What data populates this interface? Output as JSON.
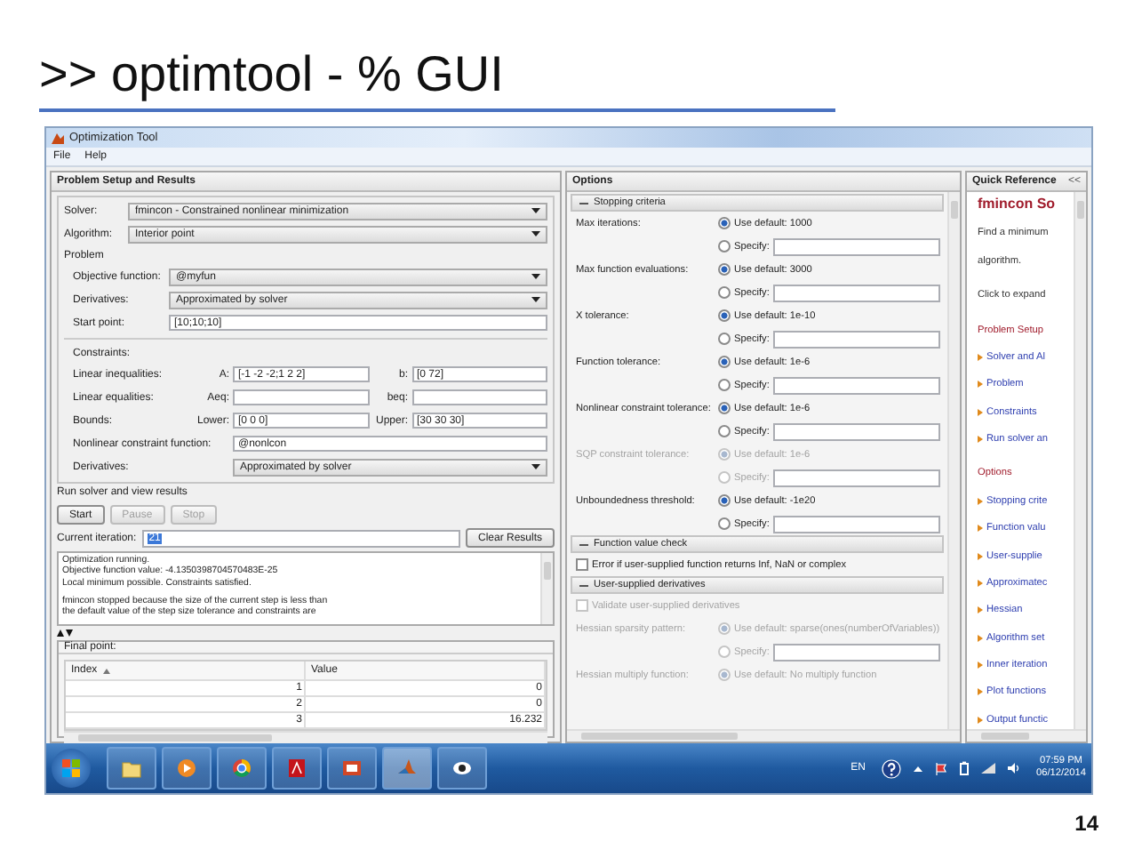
{
  "slide": {
    "title": ">> optimtool - % GUI",
    "page_number": "14"
  },
  "window": {
    "title": "Optimization Tool",
    "menu": [
      "File",
      "Help"
    ]
  },
  "problem_setup": {
    "heading": "Problem Setup and Results",
    "solver": {
      "label": "Solver:",
      "value": "fmincon - Constrained nonlinear minimization"
    },
    "algorithm": {
      "label": "Algorithm:",
      "value": "Interior point"
    },
    "problem_heading": "Problem",
    "problem_fields": [
      {
        "kind": "dropdown",
        "label": "Objective function:",
        "value": "@myfun"
      },
      {
        "kind": "dropdown",
        "label": "Derivatives:",
        "value": "Approximated by solver"
      },
      {
        "kind": "text",
        "label": "Start point:",
        "value": "[10;10;10]"
      }
    ],
    "constraints_heading": "Constraints:",
    "constraint_rows": [
      {
        "label": "Linear inequalities:",
        "fields": [
          {
            "label": "A:",
            "value": "[-1 -2 -2;1 2 2]"
          },
          {
            "label": "b:",
            "value": "[0 72]"
          }
        ]
      },
      {
        "label": "Linear equalities:",
        "fields": [
          {
            "label": "Aeq:"
          },
          {
            "label": "beq:"
          }
        ]
      },
      {
        "label": "Bounds:",
        "fields": [
          {
            "label": "Lower:",
            "value": "[0 0 0]"
          },
          {
            "label": "Upper:",
            "value": "[30 30 30]"
          }
        ]
      }
    ],
    "extra_fields": [
      {
        "kind": "text",
        "label": "Nonlinear constraint function:",
        "value": "@nonlcon"
      },
      {
        "kind": "dropdown",
        "label": "Derivatives:",
        "value": "Approximated by solver"
      }
    ]
  },
  "run": {
    "heading": "Run solver and view results",
    "buttons": [
      {
        "label": "Start",
        "disabled": false
      },
      {
        "label": "Pause",
        "disabled": true
      },
      {
        "label": "Stop",
        "disabled": true
      }
    ],
    "iteration_label": "Current iteration:",
    "iteration_value": "21",
    "clear_button": "Clear Results",
    "log": [
      [
        "Optimization running.",
        "Objective function value: -4.1350398704570483E-25",
        "Local minimum possible. Constraints satisfied."
      ],
      [
        "fmincon stopped because the size of the current step is less than",
        "the default value of the step size tolerance and constraints are"
      ]
    ],
    "final_point": {
      "heading": "Final point:",
      "columns": [
        "Index",
        "Value"
      ],
      "rows": [
        [
          "1",
          "0"
        ],
        [
          "2",
          "0"
        ],
        [
          "3",
          "16.232"
        ]
      ]
    }
  },
  "options": {
    "heading": "Options",
    "sections": [
      {
        "title": "Stopping criteria",
        "expanded": true,
        "items": [
          {
            "kind": "option",
            "label": "Max iterations:",
            "disabled": false,
            "radios": [
              {
                "kind": "default",
                "label": "Use default: 1000",
                "selected": true
              },
              {
                "kind": "specify",
                "label": "Specify:",
                "selected": false
              }
            ]
          },
          {
            "kind": "option",
            "label": "Max function evaluations:",
            "disabled": false,
            "radios": [
              {
                "kind": "default",
                "label": "Use default: 3000",
                "selected": true
              },
              {
                "kind": "specify",
                "label": "Specify:",
                "selected": false
              }
            ]
          },
          {
            "kind": "option",
            "label": "X tolerance:",
            "disabled": false,
            "radios": [
              {
                "kind": "default",
                "label": "Use default: 1e-10",
                "selected": true
              },
              {
                "kind": "specify",
                "label": "Specify:",
                "selected": false
              }
            ]
          },
          {
            "kind": "option",
            "label": "Function tolerance:",
            "disabled": false,
            "radios": [
              {
                "kind": "default",
                "label": "Use default: 1e-6",
                "selected": true
              },
              {
                "kind": "specify",
                "label": "Specify:",
                "selected": false
              }
            ]
          },
          {
            "kind": "option",
            "label": "Nonlinear constraint tolerance:",
            "disabled": false,
            "radios": [
              {
                "kind": "default",
                "label": "Use default: 1e-6",
                "selected": true
              },
              {
                "kind": "specify",
                "label": "Specify:",
                "selected": false
              }
            ]
          },
          {
            "kind": "option",
            "label": "SQP constraint tolerance:",
            "disabled": true,
            "radios": [
              {
                "kind": "default",
                "label": "Use default: 1e-6",
                "selected": true
              },
              {
                "kind": "specify",
                "label": "Specify:",
                "selected": false
              }
            ]
          },
          {
            "kind": "option",
            "label": "Unboundedness threshold:",
            "disabled": false,
            "radios": [
              {
                "kind": "default",
                "label": "Use default: -1e20",
                "selected": true
              },
              {
                "kind": "specify",
                "label": "Specify:",
                "selected": false
              }
            ]
          }
        ]
      },
      {
        "title": "Function value check",
        "expanded": true,
        "items": [
          {
            "kind": "check",
            "label": "Error if user-supplied function returns Inf, NaN or complex",
            "checked": false,
            "disabled": false
          }
        ]
      },
      {
        "title": "User-supplied derivatives",
        "expanded": true,
        "items": [
          {
            "kind": "check",
            "label": "Validate user-supplied derivatives",
            "checked": false,
            "disabled": true
          },
          {
            "kind": "option",
            "label": "Hessian sparsity pattern:",
            "disabled": true,
            "radios": [
              {
                "kind": "default",
                "label": "Use default: sparse(ones(numberOfVariables))",
                "selected": true
              },
              {
                "kind": "specify",
                "label": "Specify:",
                "selected": false
              }
            ]
          },
          {
            "kind": "option",
            "label": "Hessian multiply function:",
            "disabled": true,
            "radios": [
              {
                "kind": "default",
                "label": "Use default: No multiply function",
                "selected": true
              }
            ]
          }
        ]
      }
    ]
  },
  "quick_reference": {
    "heading": "Quick Reference",
    "collapse": "<<",
    "title": "fmincon So",
    "description": [
      "Find a minimum",
      "algorithm."
    ],
    "hint": "Click to expand",
    "groups": [
      {
        "title": "Problem Setup",
        "links": [
          "Solver and Al",
          "Problem",
          "Constraints",
          "Run solver an"
        ]
      },
      {
        "title": "Options",
        "links": [
          "Stopping crite",
          "Function valu",
          "User-supplie",
          "Approximatec",
          "Hessian",
          "Algorithm set",
          "Inner iteration",
          "Plot functions",
          "Output functic"
        ]
      }
    ]
  },
  "taskbar": {
    "language": "EN",
    "time": "07:59 PM",
    "date": "06/12/2014"
  }
}
